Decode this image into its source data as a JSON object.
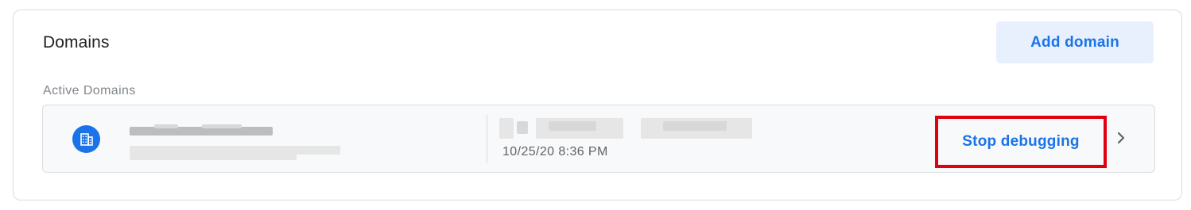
{
  "card": {
    "title": "Domains",
    "add_button_label": "Add domain",
    "section_label": "Active Domains"
  },
  "domain_row": {
    "icon": "domain-building-icon",
    "timestamp": "10/25/20 8:36 PM",
    "stop_button_label": "Stop debugging",
    "chevron_icon": "chevron-right-icon"
  },
  "colors": {
    "accent": "#1a73e8",
    "button_bg": "#e8f0fe",
    "highlight_border": "#e0000e"
  }
}
